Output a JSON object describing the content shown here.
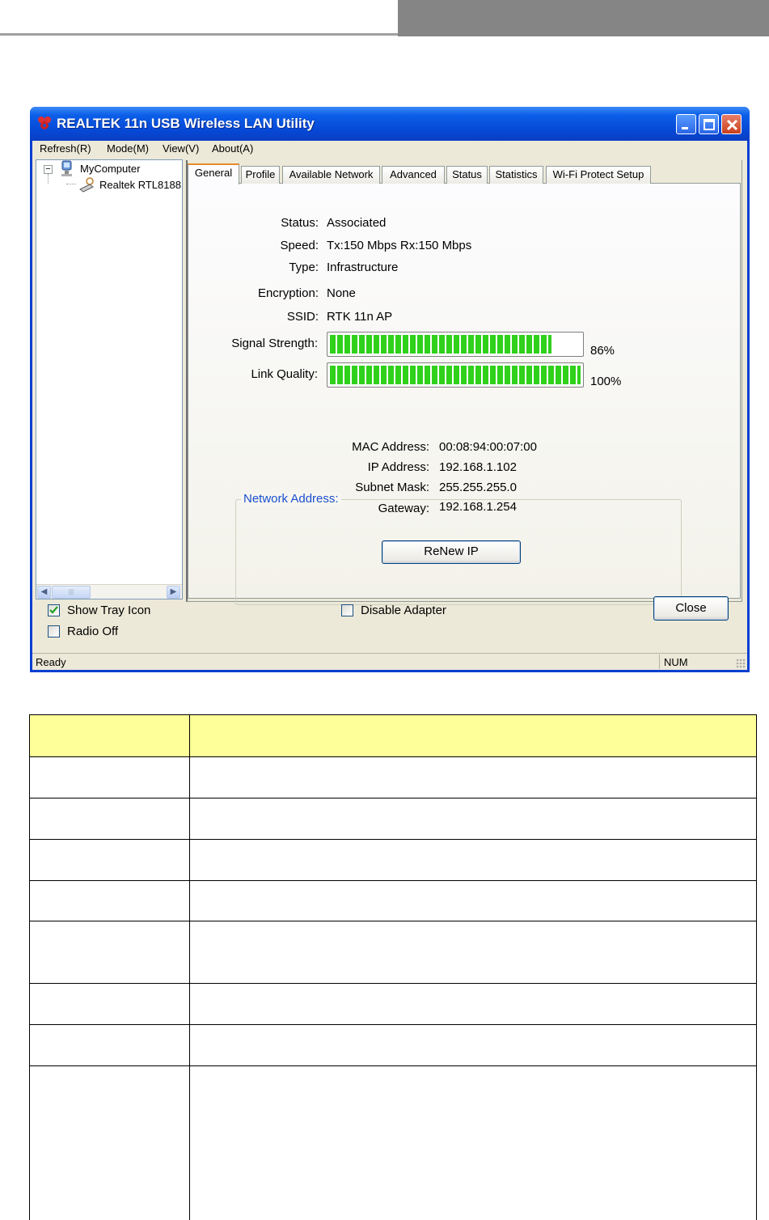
{
  "window": {
    "title": "REALTEK 11n USB Wireless LAN Utility"
  },
  "menu": {
    "items": [
      "Refresh(R)",
      "Mode(M)",
      "View(V)",
      "About(A)"
    ]
  },
  "tree": {
    "root": "MyComputer",
    "child": "Realtek RTL8188"
  },
  "tabs": [
    "General",
    "Profile",
    "Available Network",
    "Advanced",
    "Status",
    "Statistics",
    "Wi-Fi Protect Setup"
  ],
  "general": {
    "status_label": "Status:",
    "status_value": "Associated",
    "speed_label": "Speed:",
    "speed_value": "Tx:150 Mbps Rx:150 Mbps",
    "type_label": "Type:",
    "type_value": "Infrastructure",
    "encryption_label": "Encryption:",
    "encryption_value": "None",
    "ssid_label": "SSID:",
    "ssid_value": "RTK 11n AP",
    "signal_label": "Signal Strength:",
    "signal_percent": "86%",
    "signal_fraction": 0.86,
    "link_label": "Link Quality:",
    "link_percent": "100%",
    "link_fraction": 1.0,
    "network_address_title": "Network Address:",
    "mac_label": "MAC Address:",
    "mac_value": "00:08:94:00:07:00",
    "ip_label": "IP Address:",
    "ip_value": "192.168.1.102",
    "mask_label": "Subnet Mask:",
    "mask_value": "255.255.255.0",
    "gateway_label": "Gateway:",
    "gateway_value": "192.168.1.254",
    "renew_button": "ReNew IP"
  },
  "footer": {
    "show_tray_icon": "Show Tray Icon",
    "show_tray_icon_checked": true,
    "radio_off": "Radio Off",
    "radio_off_checked": false,
    "disable_adapter": "Disable Adapter",
    "disable_adapter_checked": false,
    "close_button": "Close"
  },
  "statusbar": {
    "text": "Ready",
    "num": "NUM"
  },
  "colors": {
    "titlebar": "#0b5ee8",
    "signal_fill": "#2fd11b",
    "group_title": "#1a4fcf",
    "table_header": "#ffff99"
  }
}
